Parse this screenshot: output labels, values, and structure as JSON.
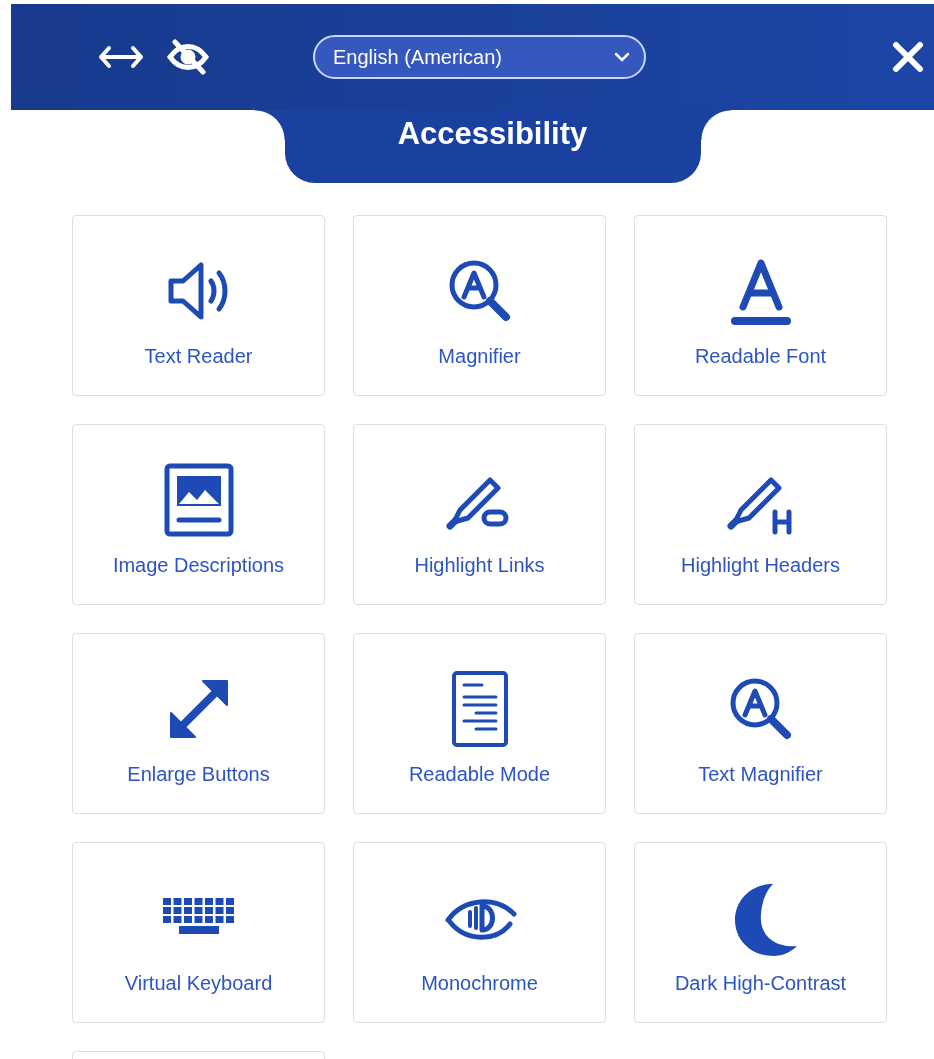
{
  "header": {
    "language": {
      "value": "English (American)"
    },
    "title": "Accessibility"
  },
  "tiles": [
    {
      "kind": "speaker",
      "label": "Text Reader"
    },
    {
      "kind": "magnifier",
      "label": "Magnifier"
    },
    {
      "kind": "font",
      "label": "Readable Font"
    },
    {
      "kind": "image",
      "label": "Image Descriptions"
    },
    {
      "kind": "highlight-link",
      "label": "Highlight Links"
    },
    {
      "kind": "highlight-header",
      "label": "Highlight Headers"
    },
    {
      "kind": "enlarge",
      "label": "Enlarge Buttons"
    },
    {
      "kind": "document",
      "label": "Readable Mode"
    },
    {
      "kind": "magnifier",
      "label": "Text Magnifier"
    },
    {
      "kind": "keyboard",
      "label": "Virtual Keyboard"
    },
    {
      "kind": "eye",
      "label": "Monochrome"
    },
    {
      "kind": "moon",
      "label": "Dark High-Contrast"
    },
    {
      "kind": "partial"
    }
  ]
}
